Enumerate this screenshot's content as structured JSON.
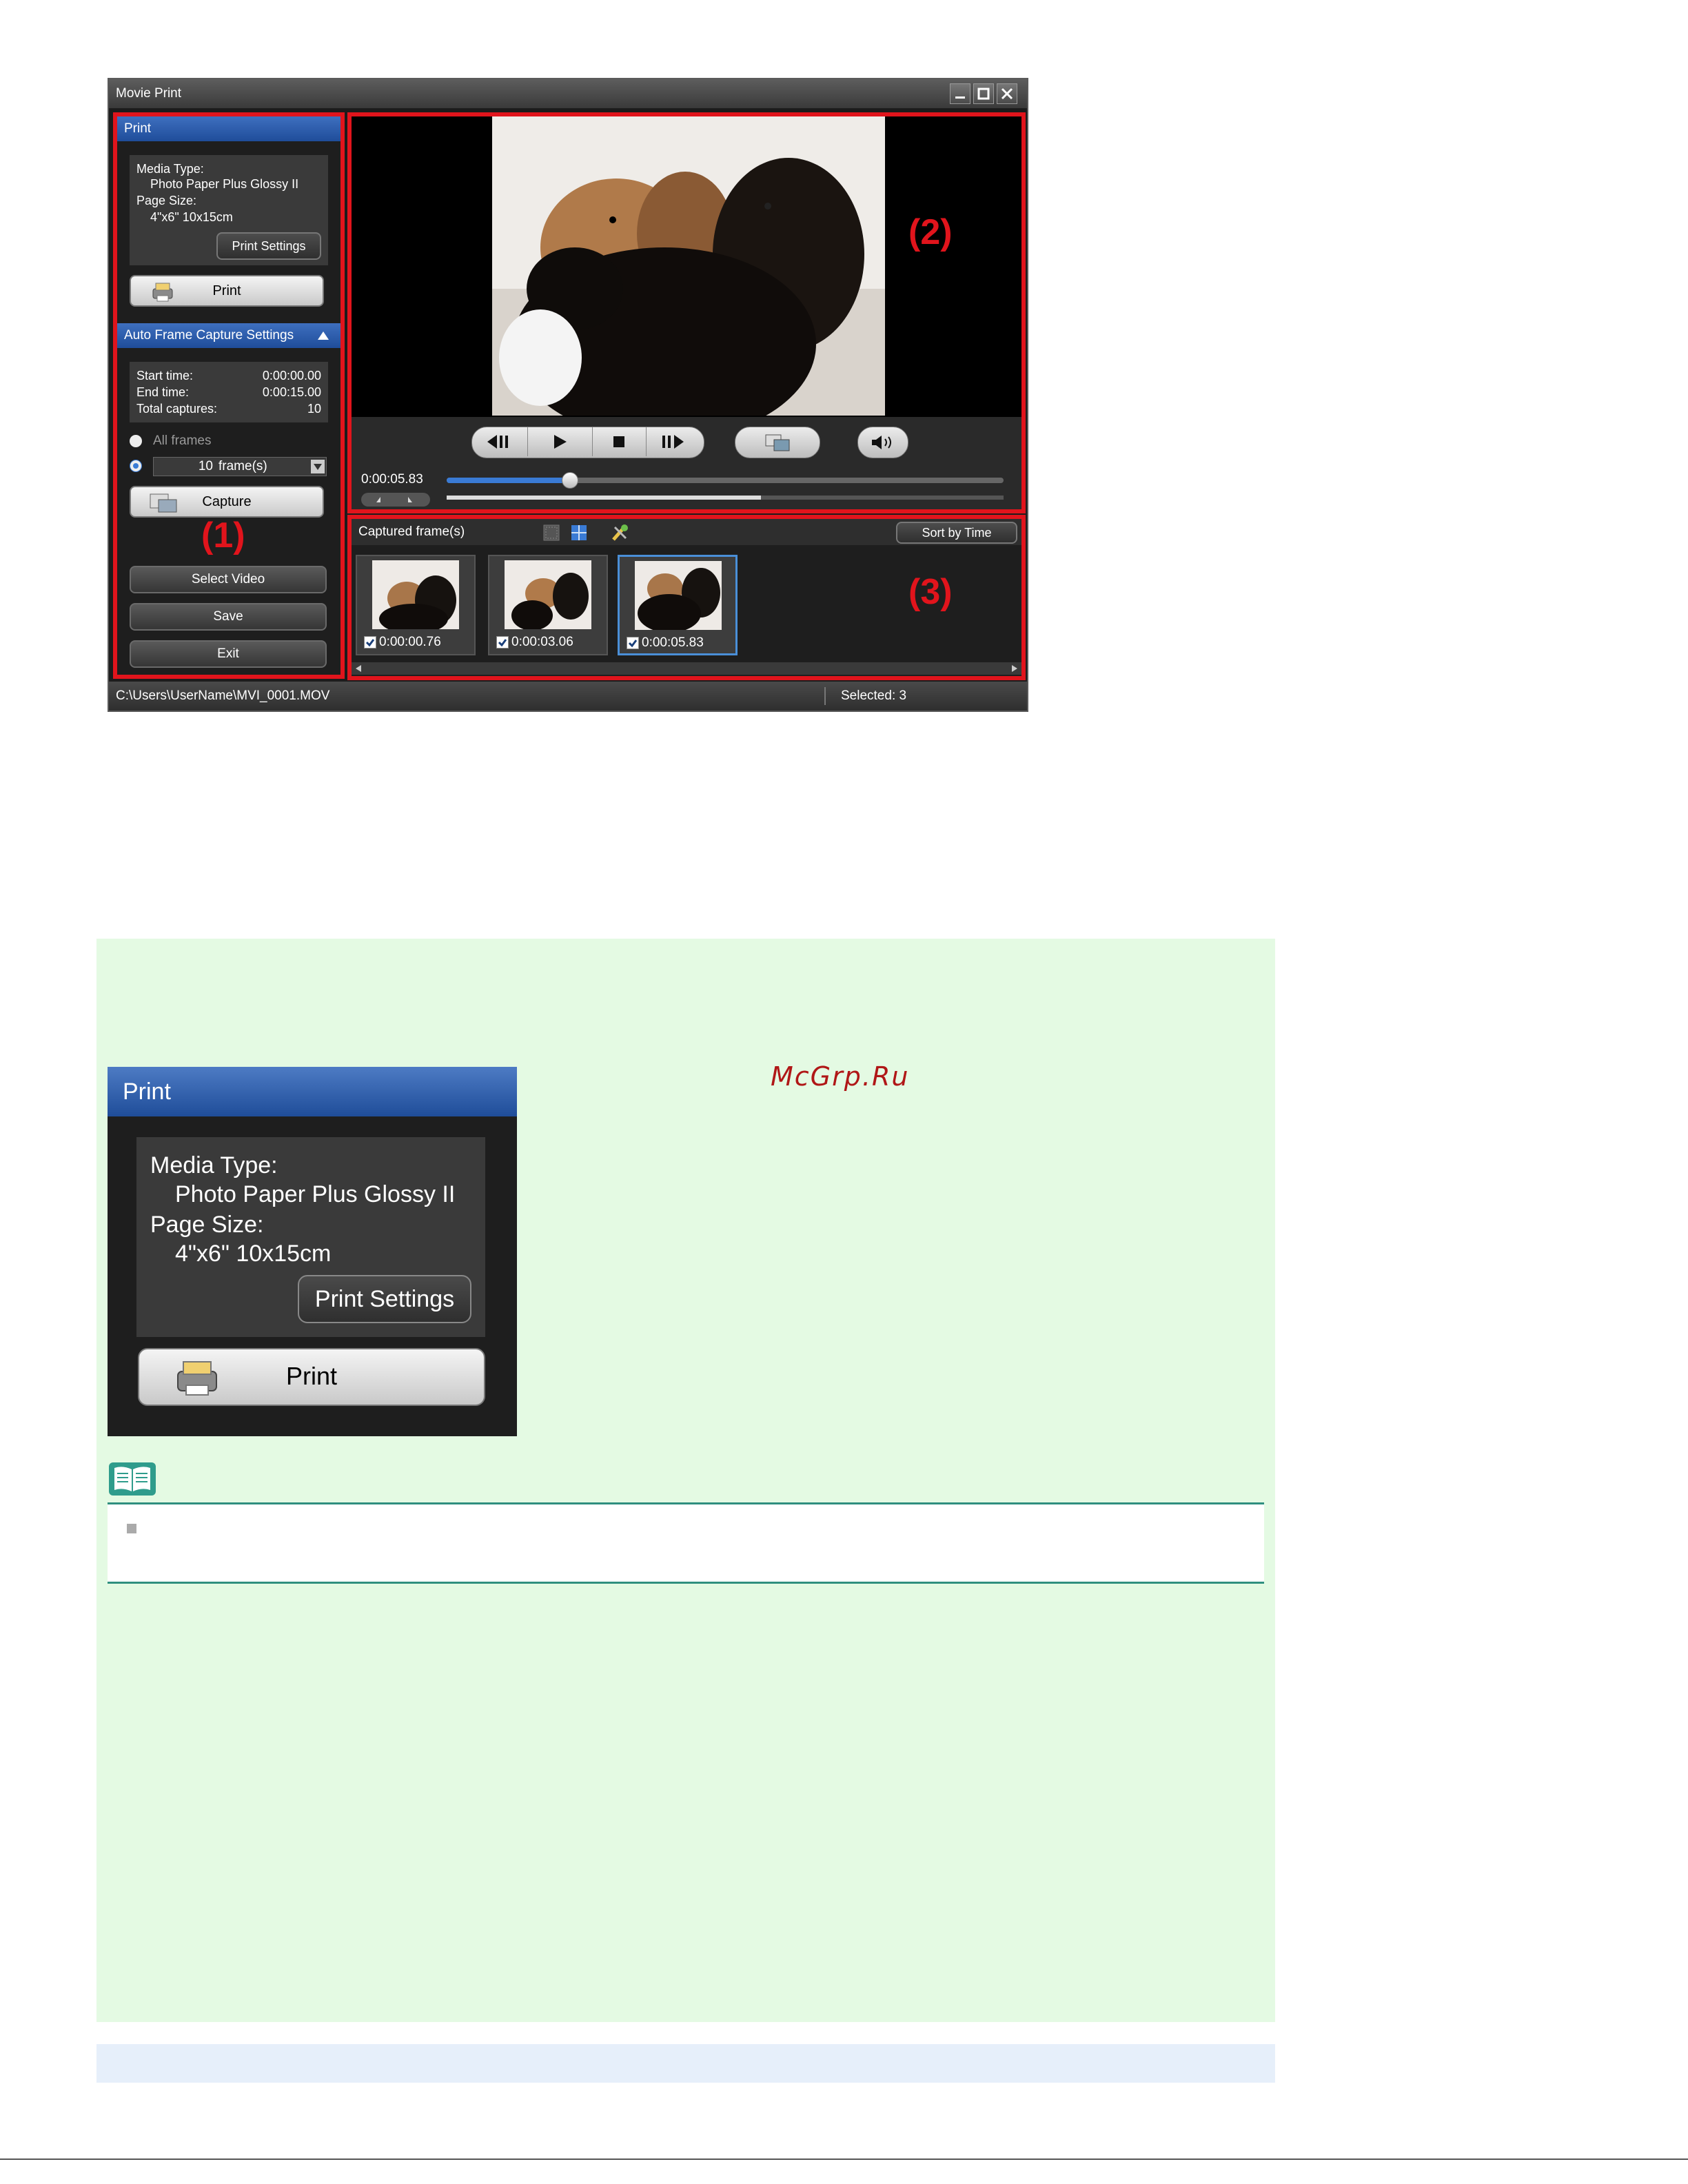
{
  "window": {
    "title": "Movie Print",
    "print_section": {
      "header": "Print",
      "media_type_label": "Media Type:",
      "media_type_value": "Photo Paper Plus Glossy II",
      "page_size_label": "Page Size:",
      "page_size_value": "4\"x6\" 10x15cm",
      "print_settings_button": "Print Settings",
      "print_button": "Print"
    },
    "capture_section": {
      "header": "Auto Frame Capture Settings",
      "start_time_label": "Start time:",
      "start_time_value": "0:00:00.00",
      "end_time_label": "End time:",
      "end_time_value": "0:00:15.00",
      "total_captures_label": "Total captures:",
      "total_captures_value": "10",
      "all_frames_label": "All frames",
      "frames_value": "10",
      "frames_unit": "frame(s)",
      "capture_button": "Capture"
    },
    "select_video_button": "Select Video",
    "save_button": "Save",
    "exit_button": "Exit",
    "label_1": "(1)",
    "label_2": "(2)",
    "label_3": "(3)",
    "playback": {
      "current_time": "0:00:05.83",
      "progress_fraction": 0.22
    },
    "captured": {
      "header": "Captured frame(s)",
      "sort_button": "Sort by Time",
      "frames": [
        {
          "time": "0:00:00.76",
          "checked": true
        },
        {
          "time": "0:00:03.06",
          "checked": true
        },
        {
          "time": "0:00:05.83",
          "checked": true
        }
      ]
    },
    "status": {
      "path": "C:\\Users\\UserName\\MVI_0001.MOV",
      "selected": "Selected: 3"
    }
  },
  "zoom": {
    "header": "Print",
    "media_type_label": "Media Type:",
    "media_type_value": "Photo Paper Plus Glossy II",
    "page_size_label": "Page Size:",
    "page_size_value": "4\"x6\" 10x15cm",
    "print_settings_button": "Print Settings",
    "print_button": "Print"
  },
  "watermark": "McGrp.Ru",
  "colors": {
    "region_border": "#e1141c",
    "section_header": "#2a5aaa",
    "green_background": "#e4fae3",
    "note_rule": "#2f8f7f"
  }
}
